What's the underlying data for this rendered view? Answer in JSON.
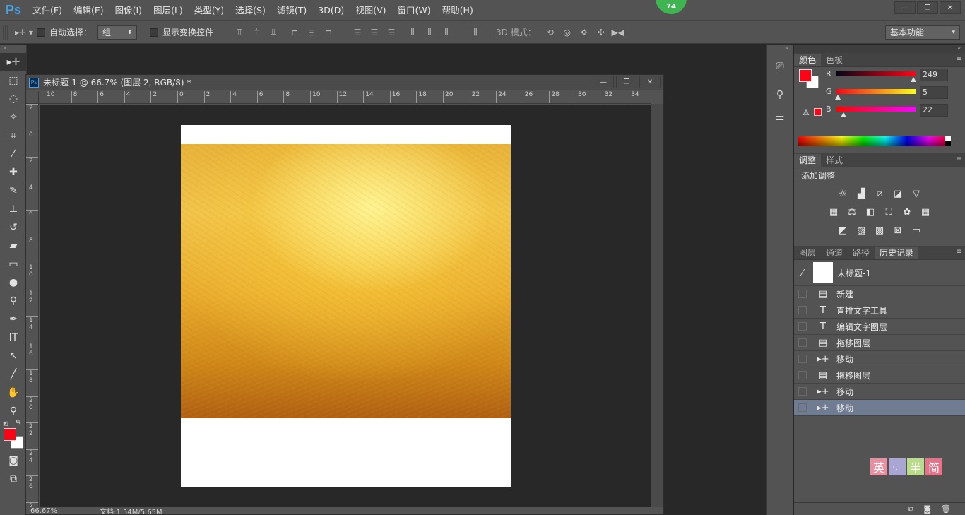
{
  "app": {
    "logo": "Ps",
    "badge": "74"
  },
  "menu": [
    "文件(F)",
    "编辑(E)",
    "图像(I)",
    "图层(L)",
    "类型(Y)",
    "选择(S)",
    "滤镜(T)",
    "3D(D)",
    "视图(V)",
    "窗口(W)",
    "帮助(H)"
  ],
  "window_controls": {
    "minimize": "—",
    "restore": "❐",
    "close": "✕"
  },
  "options": {
    "auto_select_label": "自动选择：",
    "auto_select_value": "组",
    "show_transform_label": "显示变换控件",
    "mode_3d_label": "3D 模式：",
    "workspace": "基本功能"
  },
  "document": {
    "title": "未标题-1 @ 66.7% (图层 2, RGB/8) *",
    "zoom": "66.67%",
    "doc_info": "文档:1.54M/5.65M",
    "h_ruler": [
      "10",
      "8",
      "6",
      "4",
      "2",
      "0",
      "2",
      "4",
      "6",
      "8",
      "10",
      "12",
      "14",
      "16",
      "18",
      "20",
      "22",
      "24",
      "26",
      "28",
      "30",
      "32",
      "34"
    ],
    "v_ruler": [
      "2",
      "0",
      "2",
      "4",
      "6",
      "8",
      "1 0",
      "1 2",
      "1 4",
      "1 6",
      "1 8",
      "2 0",
      "2 2",
      "2 4",
      "2 6",
      "2"
    ]
  },
  "panels": {
    "color_tabs": [
      "颜色",
      "色板"
    ],
    "color": {
      "fg": "#f90516",
      "bg": "#ffffff",
      "r": "249",
      "g": "5",
      "b": "22",
      "r_pos": 0.976,
      "g_pos": 0.02,
      "b_pos": 0.086
    },
    "adjust_tabs": [
      "调整",
      "样式"
    ],
    "adjust_title": "添加调整",
    "history_tabs": [
      "图层",
      "通道",
      "路径",
      "历史记录"
    ],
    "history_snapshot": "未标题-1",
    "history": [
      {
        "icon": "doc-icon",
        "glyph": "▤",
        "label": "新建"
      },
      {
        "icon": "type-icon",
        "glyph": "T",
        "label": "直排文字工具"
      },
      {
        "icon": "type-icon",
        "glyph": "T",
        "label": "编辑文字图层"
      },
      {
        "icon": "doc-icon",
        "glyph": "▤",
        "label": "拖移图层"
      },
      {
        "icon": "move-icon",
        "glyph": "▸+",
        "label": "移动"
      },
      {
        "icon": "doc-icon",
        "glyph": "▤",
        "label": "拖移图层"
      },
      {
        "icon": "move-icon",
        "glyph": "▸+",
        "label": "移动"
      },
      {
        "icon": "move-icon",
        "glyph": "▸+",
        "label": "移动"
      }
    ],
    "ime": [
      "英",
      "'，",
      "半",
      "简"
    ]
  }
}
